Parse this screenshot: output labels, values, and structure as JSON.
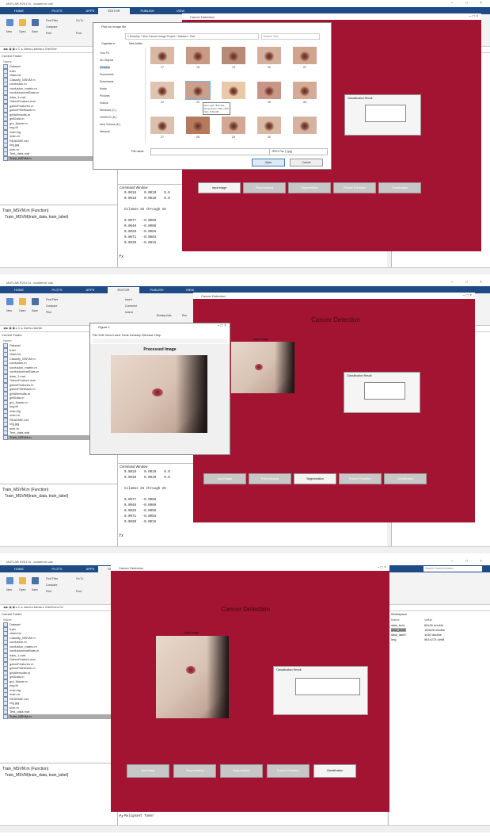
{
  "matlab": {
    "title": "MATLAB R2017a - academic use",
    "tabs": [
      "HOME",
      "PLOTS",
      "APPS",
      "EDITOR",
      "PUBLISH",
      "VIEW"
    ],
    "ribbon": {
      "new": "New",
      "open": "Open",
      "save": "Save",
      "find_files": "Find Files",
      "compare": "Compare",
      "print": "Print",
      "go_to": "Go To",
      "find": "Find",
      "insert": "Insert",
      "comment": "Comment",
      "indent": "Indent",
      "breakpoints": "Breakpoints",
      "run": "Run"
    },
    "search_placeholder": "Search Documentation",
    "current_folder_label": "Current Folder",
    "name_col": "Name",
    "files": [
      "Dataset",
      "train",
      "class.txt",
      "Classify_MSVM.m",
      "confusion.m",
      "confusion_matrix.m",
      "confusionmatStats.m",
      "data_1.mat",
      "GaborFeature.mat",
      "gaborFeatures.m",
      "gaborFilterBank.m",
      "getAllresults.m",
      "getData.m",
      "gui_Name.m",
      "img.tif",
      "main.fig",
      "main.m",
      "README.md",
      "reg.jpg",
      "svm.m",
      "Test_data.mat",
      "Train_MSVM.m"
    ],
    "selected_file": "Train_MSVM.m",
    "detail_title": "Train_MSVM.m (Function)",
    "detail_sig": "Train_MSVM(train_data, train_label)",
    "command_window": "Command Window",
    "cmd1": [
      "0.0010    0.0010    0.0",
      "0.0010    0.0010    0.0",
      "",
      "Columns 25 through 26",
      "",
      "0.0077   -0.0009",
      "0.0040   -0.0009",
      "0.0020   -0.0056",
      "0.0071   -0.0003",
      "0.0030   -0.0015"
    ],
    "cmd3": [
      "Gabor Feature",
      "GLCM Feature",
      "Contrast(1) Correlation(2) Energy(3) Homogeneity(4) Mean(5) Standard_Deviation(6) Entropy(7) RMS(8) Va",
      "Malignant Tumor"
    ],
    "workspace": "Workspace",
    "ws_cols": [
      "Name",
      "Value"
    ],
    "ws_rows": [
      [
        "data_feat",
        "60x26 double"
      ],
      [
        "data_feat1",
        "100x26 double"
      ],
      [
        "data_label",
        "1x30 double"
      ],
      [
        "img",
        "561x273 uint8"
      ]
    ],
    "fx": "fx",
    "status": "Ready"
  },
  "gui": {
    "window_title": "Cancer Detection",
    "heading": "Cancer Detection",
    "input_label": "Input Image",
    "classification_label": "Classification Result",
    "classification_value": "",
    "buttons": [
      "Input Image",
      "Preprocessing",
      "Segmentation",
      "Feature Extraction",
      "Classification"
    ],
    "active_step": [
      0,
      2,
      4
    ]
  },
  "dialog": {
    "title": "Pick an image file",
    "path": "« Desktop › Skin Cancer Image Project › Dataset › Test",
    "search": "Search Test",
    "organize": "Organize ▾",
    "new_folder": "New folder",
    "sidebar": [
      "This PC",
      "3D Objects",
      "Desktop",
      "Documents",
      "Downloads",
      "Music",
      "Pictures",
      "Videos",
      "Windows (C:)",
      "LENOVO (D:)",
      "New Volume (E:)",
      "Network"
    ],
    "selected_sidebar": "Desktop",
    "thumbs": [
      "17",
      "18",
      "19",
      "20",
      "21",
      "22",
      "23",
      "",
      "25",
      "26",
      "27",
      "28",
      "29",
      "30",
      ""
    ],
    "tooltip": "Item type: JPG File\nDimensions: 300 x 300\nSize: 5.62 KB",
    "file_name_label": "File name:",
    "filter": "JPEG File (*.jpg)",
    "open": "Open",
    "cancel": "Cancel"
  },
  "figure": {
    "title": "Figure 1",
    "menu": "File  Edit  View  Insert  Tools  Desktop  Window  Help",
    "plot_title": "Processed Image"
  },
  "colors": {
    "gui_bg": "#a31432",
    "matlab_tab": "#1e4b86"
  }
}
